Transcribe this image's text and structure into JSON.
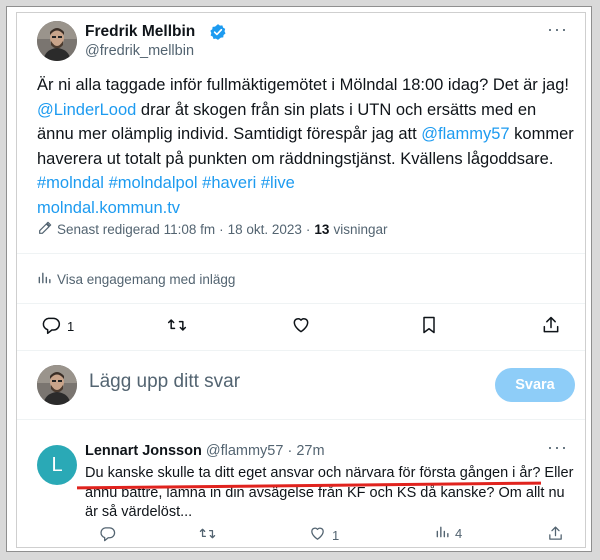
{
  "tweet": {
    "author_name": "Fredrik Mellbin",
    "author_handle": "@fredrik_mellbin",
    "text": {
      "p1": "Är ni alla taggade inför fullmäktigemötet i Mölndal 18:00 idag? Det är jag! ",
      "mention1": "@LinderLood",
      "p2": " drar åt skogen från sin plats i UTN och ersätts med en ännu mer olämplig individ. Samtidigt förespår jag att ",
      "mention2": "@flammy57",
      "p3": " kommer haverera ut totalt på punkten om räddningstjänst. Kvällens lågoddsare. ",
      "tag1": "#molndal",
      "tag2": "#molndalpol",
      "tag3": "#haveri",
      "tag4": "#live",
      "url": "molndal.kommun.tv"
    },
    "meta": {
      "edited": "Senast redigerad 11:08 fm",
      "sep1": "·",
      "date": "18 okt. 2023",
      "sep2": "·",
      "views_count": "13",
      "views_label": "visningar"
    },
    "engagement_link": "Visa engagemang med inlägg",
    "actions": {
      "reply_count": "1"
    }
  },
  "composer": {
    "placeholder": "Lägg upp ditt svar",
    "button_label": "Svara"
  },
  "reply": {
    "avatar_letter": "L",
    "author_name": "Lennart Jonsson",
    "author_handle": "@flammy57",
    "sep": "·",
    "time": "27m",
    "text": "Du kanske skulle ta ditt eget ansvar och närvara för första gången i år? Eller ännu bättre, lämna in din avsägelse från KF och KS då kanske? Om allt nu är så värdelöst...",
    "actions": {
      "like_count": "1",
      "views_count": "4"
    }
  },
  "icons": {
    "verified": "verified-badge-icon",
    "more": "more-options-icon",
    "reply": "reply-icon",
    "retweet": "retweet-icon",
    "like": "like-icon",
    "bookmark": "bookmark-icon",
    "share": "share-icon",
    "views": "views-chart-icon",
    "edit": "edit-pencil-icon"
  },
  "colors": {
    "link": "#1d9bf0",
    "secondary_text": "#536471",
    "reply_button_disabled": "#8ecdf8",
    "reply_avatar": "#2aa9b6",
    "annotation_underline": "#e0231e"
  }
}
